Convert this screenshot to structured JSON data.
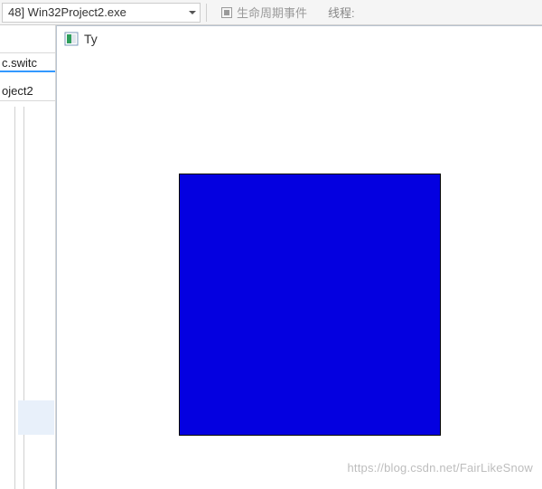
{
  "ide": {
    "process_combo": {
      "text": "48] Win32Project2.exe"
    },
    "lifecycle_label": "生命周期事件",
    "thread_label": "线程:",
    "tabs": {
      "switch_text": "c.switc",
      "project_text": "oject2"
    }
  },
  "app": {
    "title": "Ty",
    "square_color": "#0400e0"
  },
  "watermark": "https://blog.csdn.net/FairLikeSnow"
}
